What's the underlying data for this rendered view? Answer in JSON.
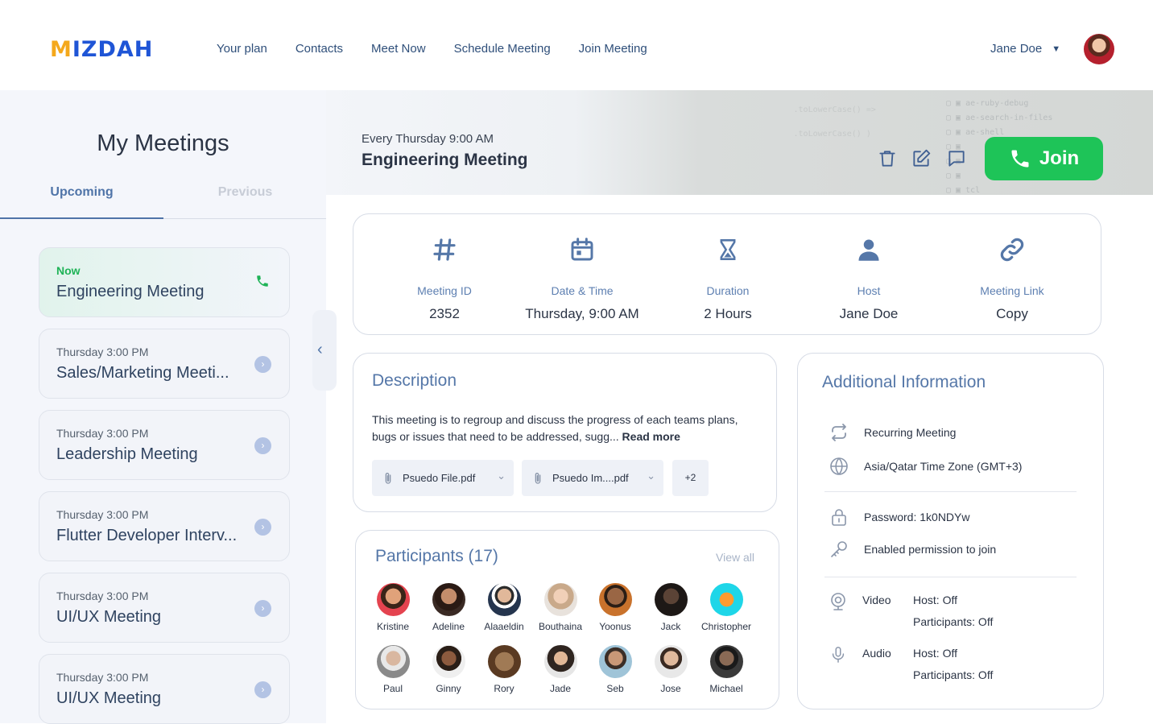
{
  "brand": {
    "name": "MIZDAH",
    "primary": "#1f55d6",
    "accent": "#f4a81c"
  },
  "nav": {
    "items": [
      "Your plan",
      "Contacts",
      "Meet Now",
      "Schedule Meeting",
      "Join Meeting"
    ]
  },
  "user": {
    "name": "Jane Doe"
  },
  "sidebar": {
    "title": "My Meetings",
    "tabs": {
      "upcoming": "Upcoming",
      "previous": "Previous"
    },
    "meetings": [
      {
        "time": "Now",
        "name": "Engineering Meeting"
      },
      {
        "time": "Thursday 3:00 PM",
        "name": "Sales/Marketing Meeti..."
      },
      {
        "time": "Thursday 3:00 PM",
        "name": "Leadership Meeting"
      },
      {
        "time": "Thursday 3:00 PM",
        "name": "Flutter Developer Interv..."
      },
      {
        "time": "Thursday 3:00 PM",
        "name": "UI/UX Meeting"
      },
      {
        "time": "Thursday 3:00 PM",
        "name": "UI/UX Meeting"
      }
    ]
  },
  "header": {
    "recurrence": "Every Thursday 9:00 AM",
    "title": "Engineering Meeting",
    "join_label": "Join",
    "join_color": "#1ec458"
  },
  "stats": {
    "meeting_id": {
      "label": "Meeting ID",
      "value": "2352"
    },
    "datetime": {
      "label": "Date & Time",
      "value": "Thursday, 9:00 AM"
    },
    "duration": {
      "label": "Duration",
      "value": "2 Hours"
    },
    "host": {
      "label": "Host",
      "value": "Jane Doe"
    },
    "link": {
      "label": "Meeting Link",
      "value": "Copy"
    }
  },
  "description": {
    "title": "Description",
    "text": "This meeting is to regroup and discuss the progress of each teams plans, bugs or issues that need to be addressed, sugg...",
    "read_more": "Read more",
    "files": [
      "Psuedo File.pdf",
      "Psuedo Im....pdf"
    ],
    "more_files": "+2"
  },
  "participants": {
    "title": "Participants (17)",
    "view_all": "View all",
    "people": [
      "Kristine",
      "Adeline",
      "Alaaeldin",
      "Bouthaina",
      "Yoonus",
      "Jack",
      "Christopher",
      "Paul",
      "Ginny",
      "Rory",
      "Jade",
      "Seb",
      "Jose",
      "Michael"
    ]
  },
  "additional": {
    "title": "Additional Information",
    "recurring": "Recurring Meeting",
    "timezone": "Asia/Qatar Time Zone (GMT+3)",
    "password": "Password: 1k0NDYw",
    "permission": "Enabled permission to join",
    "video": {
      "label": "Video",
      "host": "Host: Off",
      "participants": "Participants: Off"
    },
    "audio": {
      "label": "Audio",
      "host": "Host: Off",
      "participants": "Participants: Off"
    }
  }
}
